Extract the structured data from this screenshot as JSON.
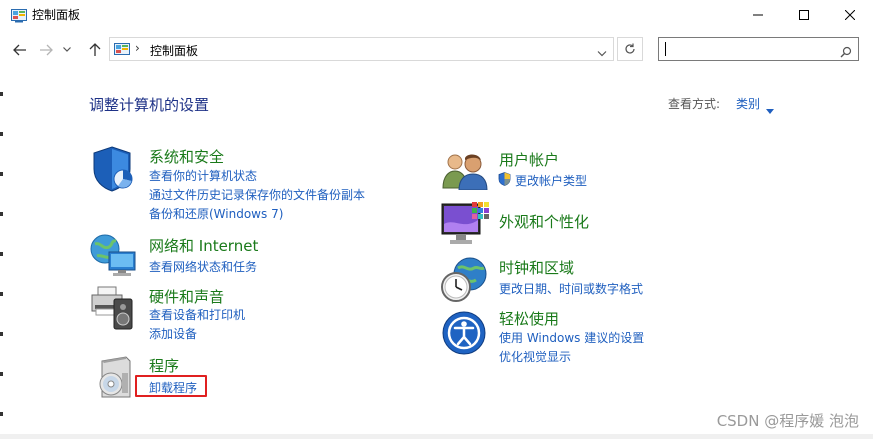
{
  "window": {
    "title": "控制面板"
  },
  "nav": {
    "breadcrumb_sep": "›",
    "breadcrumb": "控制面板",
    "search_placeholder": "",
    "search_value": ""
  },
  "header": {
    "title": "调整计算机的设置",
    "view_by_label": "查看方式:",
    "view_by_value": "类别"
  },
  "categories": [
    {
      "icon": "shield-icon",
      "title": "系统和安全",
      "links": [
        "查看你的计算机状态",
        "通过文件历史记录保存你的文件备份副本",
        "备份和还原(Windows 7)"
      ]
    },
    {
      "icon": "network-globe-icon",
      "title": "网络和 Internet",
      "links": [
        "查看网络状态和任务"
      ]
    },
    {
      "icon": "printer-speaker-icon",
      "title": "硬件和声音",
      "links": [
        "查看设备和打印机",
        "添加设备"
      ]
    },
    {
      "icon": "programs-disc-icon",
      "title": "程序",
      "links": [
        "卸载程序"
      ]
    },
    {
      "icon": "users-icon",
      "title": "用户帐户",
      "links": [
        "更改帐户类型"
      ]
    },
    {
      "icon": "monitor-palette-icon",
      "title": "外观和个性化",
      "links": []
    },
    {
      "icon": "clock-globe-icon",
      "title": "时钟和区域",
      "links": [
        "更改日期、时间或数字格式"
      ]
    },
    {
      "icon": "ease-of-access-icon",
      "title": "轻松使用",
      "links": [
        "使用 Windows 建议的设置",
        "优化视觉显示"
      ]
    }
  ],
  "watermark": "CSDN @程序媛 泡泡",
  "colors": {
    "heading": "#1e3287",
    "category_title": "#1a7a1a",
    "link": "#1f5fbf",
    "highlight": "#e02020"
  }
}
